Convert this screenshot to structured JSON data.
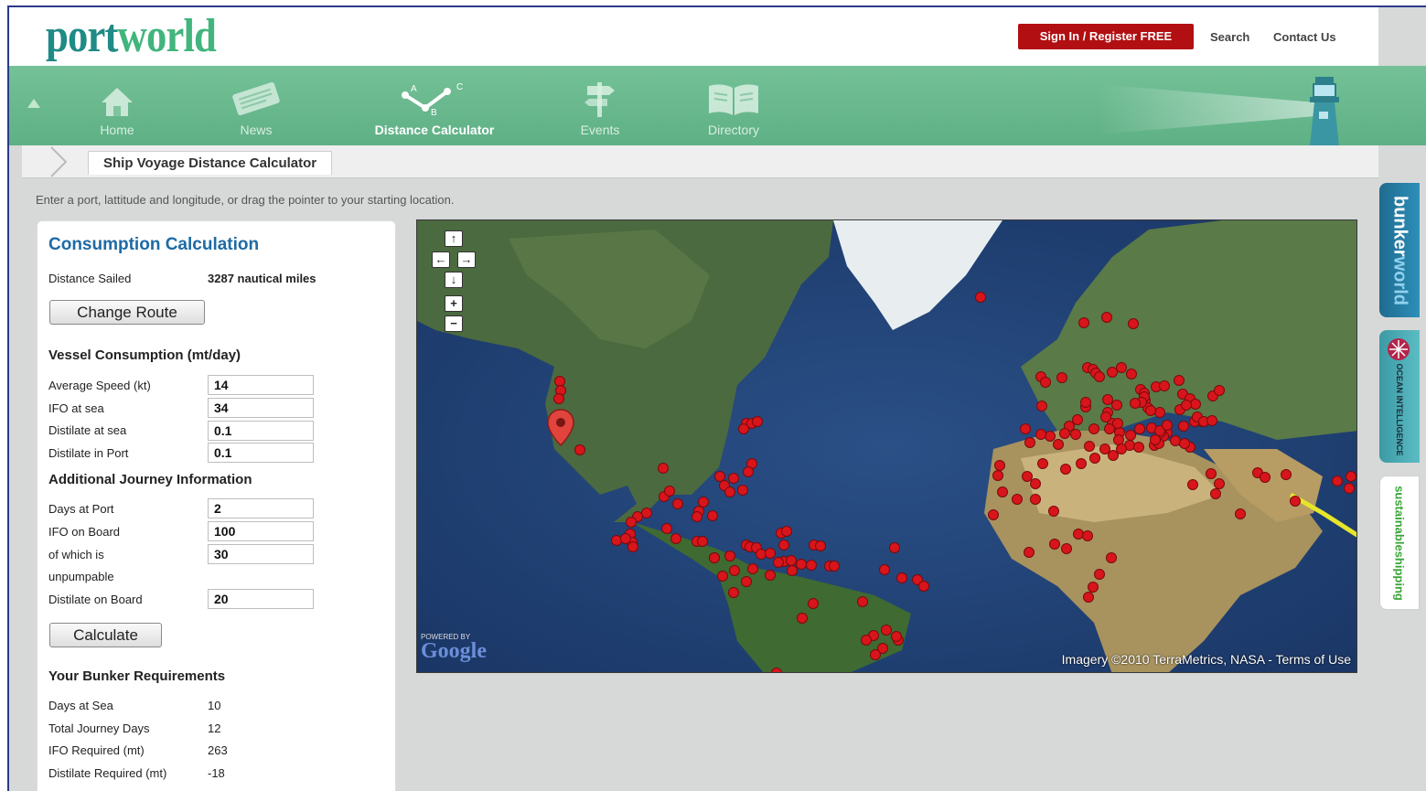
{
  "header": {
    "logo_part1": "port",
    "logo_part2": "world",
    "signin_label": "Sign In / Register FREE",
    "search_label": "Search",
    "contact_label": "Contact Us"
  },
  "nav": {
    "items": [
      {
        "label": "Home",
        "icon": "home-icon"
      },
      {
        "label": "News",
        "icon": "newspaper-icon"
      },
      {
        "label": "Distance Calculator",
        "icon": "route-icon",
        "active": true
      },
      {
        "label": "Events",
        "icon": "signpost-icon"
      },
      {
        "label": "Directory",
        "icon": "book-icon"
      }
    ],
    "route_points": [
      "A",
      "B",
      "C"
    ]
  },
  "breadcrumb": {
    "tab": "Ship Voyage Distance Calculator"
  },
  "instruction": "Enter a port, lattitude and longitude, or drag the pointer to your starting location.",
  "panel": {
    "title": "Consumption Calculation",
    "distance_label": "Distance Sailed",
    "distance_value": "3287 nautical miles",
    "change_route": "Change Route",
    "vessel_heading": "Vessel Consumption (mt/day)",
    "vessel_fields": [
      {
        "label": "Average Speed (kt)",
        "value": "14"
      },
      {
        "label": "IFO at sea",
        "value": "34"
      },
      {
        "label": "Distilate at sea",
        "value": "0.1"
      },
      {
        "label": "Distilate in Port",
        "value": "0.1"
      }
    ],
    "journey_heading": "Additional Journey Information",
    "days_port_label": "Days at Port",
    "days_port_value": "2",
    "ifo_board_label": "IFO on Board",
    "ifo_board_value": "100",
    "unpump_label_1": "of which is",
    "unpump_label_2": "unpumpable",
    "unpump_value": "30",
    "dist_board_label": "Distilate on Board",
    "dist_board_value": "20",
    "calculate": "Calculate",
    "bunker_heading": "Your Bunker Requirements",
    "results": [
      {
        "label": "Days at Sea",
        "value": "10"
      },
      {
        "label": "Total Journey Days",
        "value": "12"
      },
      {
        "label": "IFO Required (mt)",
        "value": "263"
      },
      {
        "label": "Distilate Required (mt)",
        "value": "-18"
      }
    ]
  },
  "map": {
    "controls": [
      "↑",
      "←",
      "→",
      "↓",
      "+",
      "−"
    ],
    "powered_by": "POWERED BY",
    "google_logo": "Google",
    "attribution": "Imagery ©2010 TerraMetrics, NASA - Terms of Use",
    "marker_color": "#d8151b"
  },
  "sidetabs": {
    "bunker_part1": "bunker",
    "bunker_part2": "world",
    "ocean": "OCEAN INTELLIGENCE",
    "sustainable": "sustainableshipping"
  }
}
